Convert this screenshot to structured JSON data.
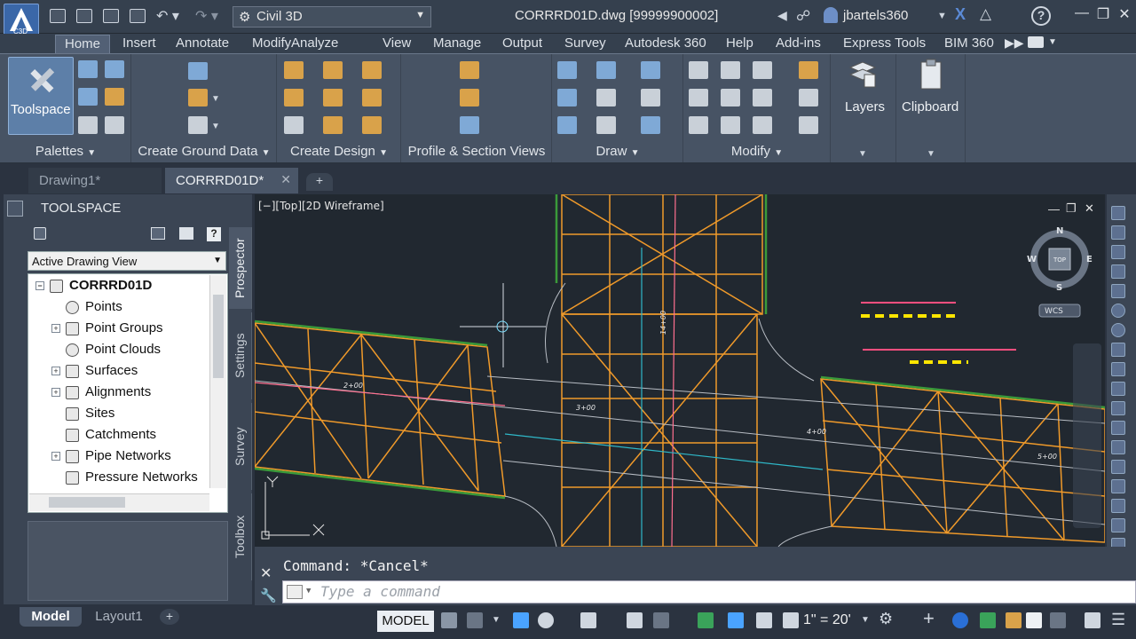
{
  "titlebar": {
    "app_badge": "C3D",
    "workspace": "Civil 3D",
    "document_title": "CORRRD01D.dwg [99999900002]",
    "user": "jbartels360"
  },
  "ribbon_tabs": [
    "Home",
    "Insert",
    "Annotate",
    "Modify",
    "Analyze",
    "View",
    "Manage",
    "Output",
    "Survey",
    "Autodesk 360",
    "Help",
    "Add-ins",
    "Express Tools",
    "BIM 360"
  ],
  "ribbon": {
    "toolspace_label": "Toolspace",
    "layers_label": "Layers",
    "clipboard_label": "Clipboard",
    "panels": [
      "Palettes",
      "Create Ground Data",
      "Create Design",
      "Profile & Section Views",
      "Draw",
      "Modify"
    ]
  },
  "doc_tabs": [
    "Drawing1*",
    "CORRRD01D*"
  ],
  "toolspace": {
    "title": "TOOLSPACE",
    "view_select": "Active Drawing View",
    "root": "CORRRD01D",
    "items": [
      "Points",
      "Point Groups",
      "Point Clouds",
      "Surfaces",
      "Alignments",
      "Sites",
      "Catchments",
      "Pipe Networks",
      "Pressure Networks"
    ],
    "side_tabs": [
      "Prospector",
      "Settings",
      "Survey",
      "Toolbox"
    ]
  },
  "viewport": {
    "label": "[−][Top][2D Wireframe]",
    "viewcube_top": "TOP",
    "compass": {
      "n": "N",
      "s": "S",
      "e": "E",
      "w": "W"
    },
    "wcs": "WCS",
    "stations": [
      "2+00",
      "3+00",
      "4+00",
      "5+00",
      "14+00"
    ]
  },
  "command": {
    "history": "Command: *Cancel*",
    "placeholder": "Type a command"
  },
  "status": {
    "model_tab": "Model",
    "layout_tab": "Layout1",
    "model_btn": "MODEL",
    "scale": "1\" = 20'"
  },
  "colors": {
    "accent": "#3a67a8",
    "corridor": "#f09a2a",
    "canvas_bg": "#212830"
  }
}
